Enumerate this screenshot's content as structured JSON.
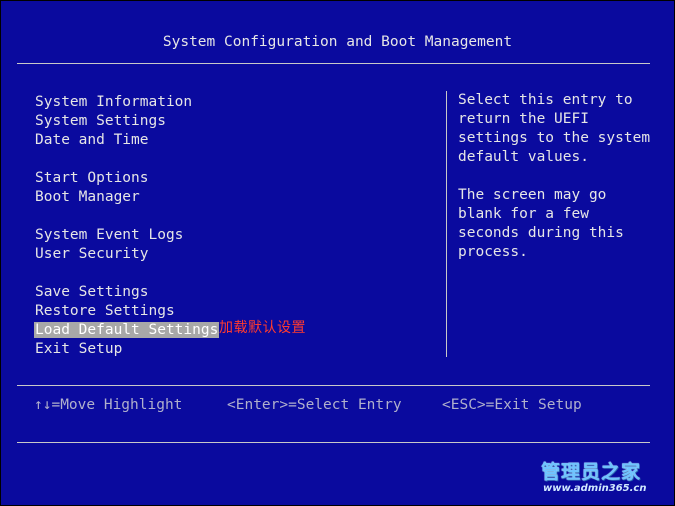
{
  "title": "System Configuration and Boot Management",
  "menu": {
    "groups": [
      [
        "System Information",
        "System Settings",
        "Date and Time"
      ],
      [
        "Start Options",
        "Boot Manager"
      ],
      [
        "System Event Logs",
        "User Security"
      ],
      [
        "Save Settings",
        "Restore Settings",
        "Load Default Settings",
        "Exit Setup"
      ]
    ],
    "selected": "Load Default Settings"
  },
  "annotation": "加载默认设置",
  "help": [
    "Select this entry to",
    "return the UEFI",
    "settings to the system",
    "default values.",
    "",
    "The screen may go",
    "blank for a few",
    "seconds during this",
    "process."
  ],
  "footer": {
    "move": "↑↓=Move Highlight",
    "enter": "<Enter>=Select Entry",
    "esc": "<ESC>=Exit Setup"
  },
  "watermark": {
    "title": "管理员之家",
    "url": "www.admin365.cn"
  },
  "colors": {
    "background": "#0a0a9e",
    "highlight": "#a8a8a8",
    "annotation": "#ff3b2f"
  }
}
